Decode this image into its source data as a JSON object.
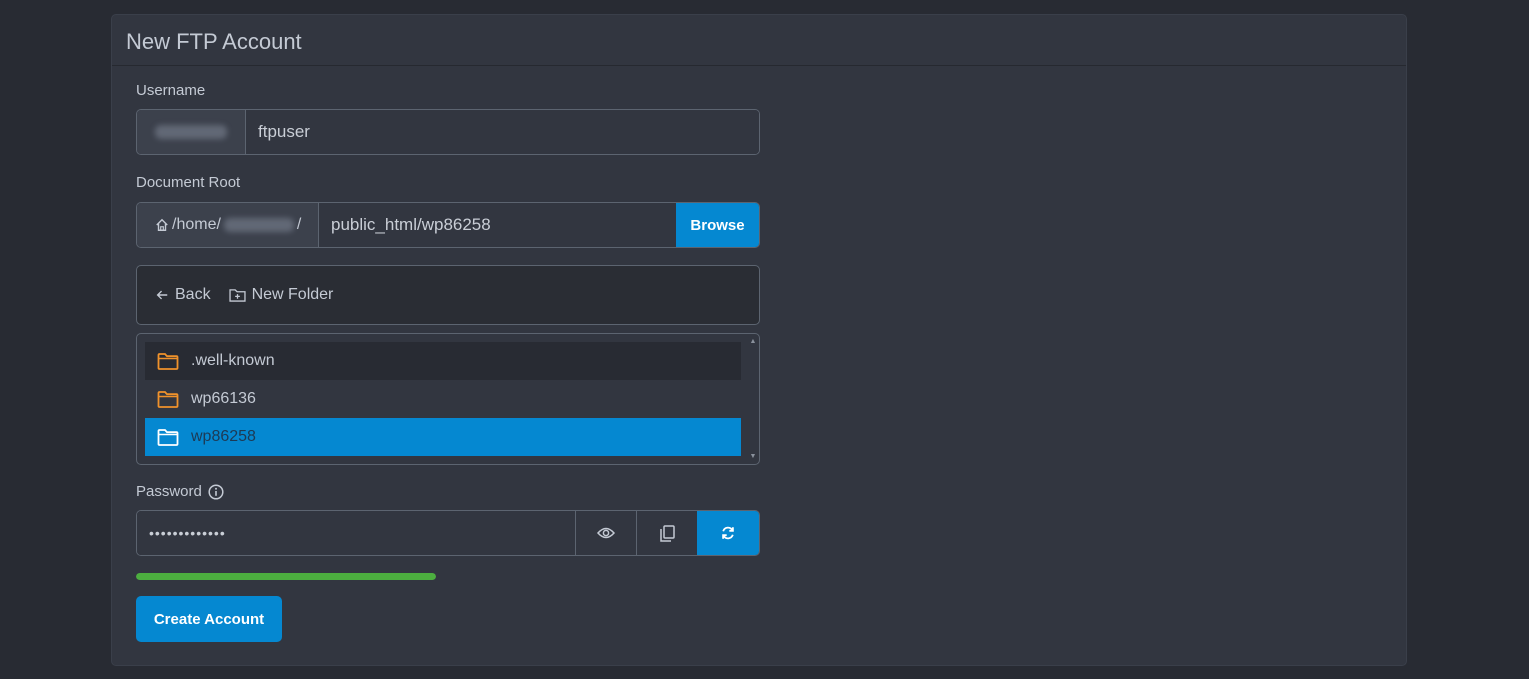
{
  "card": {
    "title": "New FTP Account"
  },
  "username": {
    "label": "Username",
    "value": "ftpuser"
  },
  "docroot": {
    "label": "Document Root",
    "prefix": "/home/",
    "prefix_suffix": "/",
    "value": "public_html/wp86258",
    "browse_label": "Browse"
  },
  "browser": {
    "back_label": "Back",
    "new_folder_label": "New Folder",
    "items": [
      {
        "name": ".well-known"
      },
      {
        "name": "wp66136"
      },
      {
        "name": "wp86258"
      }
    ],
    "selected": "wp86258"
  },
  "password": {
    "label": "Password",
    "value": "•••••••••••••",
    "strength": 1.0
  },
  "create_label": "Create Account",
  "colors": {
    "accent": "#0588d1",
    "folder": "#f0922b",
    "strength": "#4cae3f"
  }
}
